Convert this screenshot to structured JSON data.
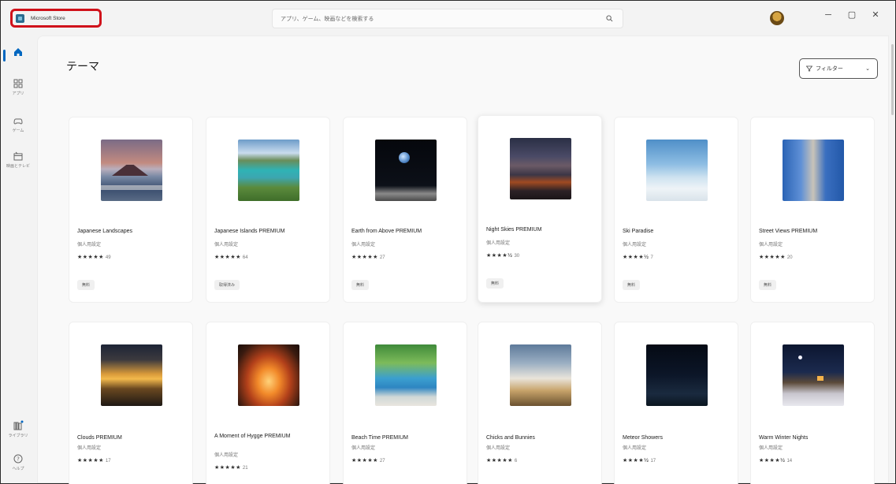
{
  "titlebar": {
    "app_title": "Microsoft Store",
    "search_placeholder": "アプリ、ゲーム、映画などを検索する",
    "minimize": "─",
    "maximize": "▢",
    "close": "✕"
  },
  "sidebar": {
    "items": [
      {
        "label": "",
        "icon": "home-icon"
      },
      {
        "label": "アプリ",
        "icon": "apps-icon"
      },
      {
        "label": "ゲーム",
        "icon": "games-icon"
      },
      {
        "label": "映画とテレビ",
        "icon": "movies-icon"
      },
      {
        "label": "ライブラリ",
        "icon": "library-icon"
      },
      {
        "label": "ヘルプ",
        "icon": "help-icon"
      }
    ]
  },
  "main": {
    "title": "テーマ",
    "filter_label": "フィルター"
  },
  "cards": [
    {
      "title": "Japanese Landscapes",
      "subtitle": "個人用設定",
      "stars": "★★★★★",
      "count": "49",
      "badge": "無料"
    },
    {
      "title": "Japanese Islands PREMIUM",
      "subtitle": "個人用設定",
      "stars": "★★★★★",
      "count": "64",
      "badge": "取得済み"
    },
    {
      "title": "Earth from Above PREMIUM",
      "subtitle": "個人用設定",
      "stars": "★★★★★",
      "count": "27",
      "badge": "無料"
    },
    {
      "title": "Night Skies PREMIUM",
      "subtitle": "個人用設定",
      "stars": "★★★★½",
      "count": "30",
      "badge": "無料"
    },
    {
      "title": "Ski Paradise",
      "subtitle": "個人用設定",
      "stars": "★★★★½",
      "count": "7",
      "badge": "無料"
    },
    {
      "title": "Street Views PREMIUM",
      "subtitle": "個人用設定",
      "stars": "★★★★★",
      "count": "20",
      "badge": "無料"
    },
    {
      "title": "Clouds PREMIUM",
      "subtitle": "個人用設定",
      "stars": "★★★★★",
      "count": "17",
      "badge": ""
    },
    {
      "title": "A Moment of Hygge PREMIUM",
      "subtitle": "個人用設定",
      "stars": "★★★★★",
      "count": "21",
      "badge": ""
    },
    {
      "title": "Beach Time PREMIUM",
      "subtitle": "個人用設定",
      "stars": "★★★★★",
      "count": "27",
      "badge": ""
    },
    {
      "title": "Chicks and Bunnies",
      "subtitle": "個人用設定",
      "stars": "★★★★★",
      "count": "6",
      "badge": ""
    },
    {
      "title": "Meteor Showers",
      "subtitle": "個人用設定",
      "stars": "★★★★½",
      "count": "17",
      "badge": ""
    },
    {
      "title": "Warm Winter Nights",
      "subtitle": "個人用設定",
      "stars": "★★★★½",
      "count": "14",
      "badge": ""
    }
  ],
  "colors": {
    "accent": "#0067c0",
    "highlight_border": "#d0121b"
  }
}
